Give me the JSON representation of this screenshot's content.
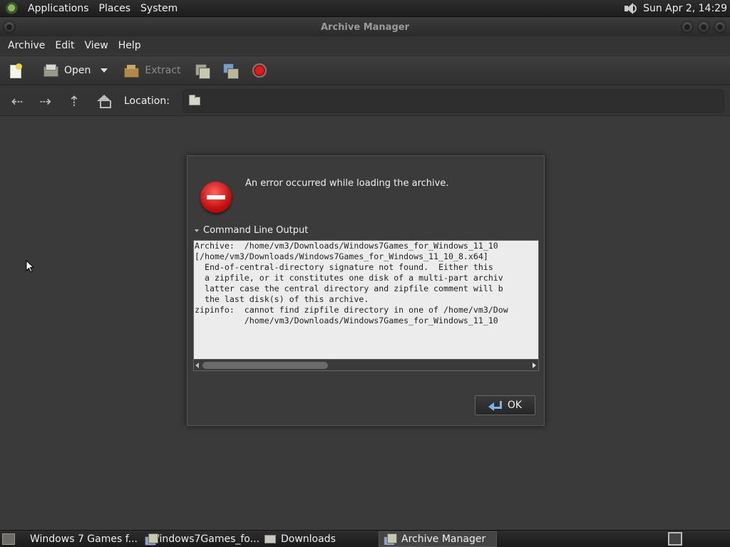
{
  "top_panel": {
    "menus": [
      "Applications",
      "Places",
      "System"
    ],
    "clock": "Sun Apr  2, 14:29"
  },
  "window": {
    "title": "Archive Manager"
  },
  "menubar": {
    "items": [
      "Archive",
      "Edit",
      "View",
      "Help"
    ]
  },
  "toolbar": {
    "open_label": "Open",
    "extract_label": "Extract"
  },
  "location_bar": {
    "label": "Location:"
  },
  "dialog": {
    "message": "An error occurred while loading the archive.",
    "expander_label": "Command Line Output",
    "output_lines": [
      "Archive:  /home/vm3/Downloads/Windows7Games_for_Windows_11_10",
      "[/home/vm3/Downloads/Windows7Games_for_Windows_11_10_8.x64]",
      "  End-of-central-directory signature not found.  Either this",
      "  a zipfile, or it constitutes one disk of a multi-part archiv",
      "  latter case the central directory and zipfile comment will b",
      "  the last disk(s) of this archive.",
      "zipinfo:  cannot find zipfile directory in one of /home/vm3/Dow",
      "          /home/vm3/Downloads/Windows7Games_for_Windows_11_10"
    ],
    "ok_label": "OK"
  },
  "taskbar": {
    "tasks": [
      {
        "label": "Windows 7 Games f...",
        "icon": "firefox-icon",
        "active": false
      },
      {
        "label": "Windows7Games_fo...",
        "icon": "archive-icon",
        "active": false
      },
      {
        "label": "Downloads",
        "icon": "folder-icon",
        "active": false
      },
      {
        "label": "Archive Manager",
        "icon": "archive-icon",
        "active": true
      }
    ]
  },
  "colors": {
    "background": "#3a3a3a",
    "error_red": "#c41010",
    "output_bg": "#ececec"
  }
}
